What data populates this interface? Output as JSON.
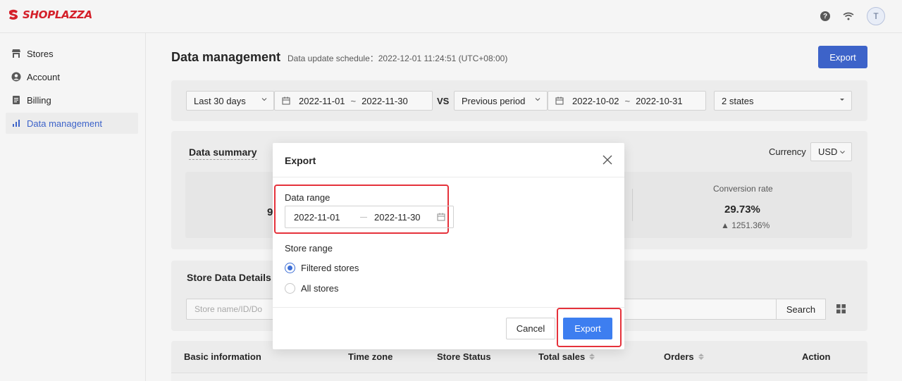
{
  "app": {
    "logo_text": "SHOPLAZZA",
    "avatar_initial": "T"
  },
  "sidebar": {
    "items": [
      {
        "label": "Stores",
        "icon": "store-icon"
      },
      {
        "label": "Account",
        "icon": "user-icon"
      },
      {
        "label": "Billing",
        "icon": "billing-icon"
      },
      {
        "label": "Data management",
        "icon": "bar-chart-icon",
        "active": true
      }
    ]
  },
  "page": {
    "title": "Data management",
    "schedule": "Data update schedule：2022-12-01 11:24:51 (UTC+08:00)",
    "export_label": "Export"
  },
  "filters": {
    "period": "Last 30 days",
    "range_start": "2022-11-01",
    "range_end": "2022-11-30",
    "tilde": "~",
    "vs_label": "VS",
    "compare_period": "Previous period",
    "compare_start": "2022-10-02",
    "compare_end": "2022-10-31",
    "states": "2 states"
  },
  "summary": {
    "title": "Data summary",
    "currency_label": "Currency",
    "currency_value": "USD",
    "partial_value": "9",
    "conversion_label": "Conversion rate",
    "conversion_value": "29.73%",
    "conversion_change": "▲ 1251.36%"
  },
  "store_details": {
    "title": "Store Data Details",
    "search_placeholder": "Store name/ID/Do",
    "search_button": "Search"
  },
  "table": {
    "columns": [
      {
        "label": "Basic information",
        "sortable": false
      },
      {
        "label": "Time zone",
        "sortable": false
      },
      {
        "label": "Store Status",
        "sortable": false
      },
      {
        "label": "Total sales",
        "sortable": true
      },
      {
        "label": "Orders",
        "sortable": true
      },
      {
        "label": "Action",
        "sortable": false
      }
    ]
  },
  "modal": {
    "title": "Export",
    "data_range_label": "Data range",
    "range_start": "2022-11-01",
    "range_end": "2022-11-30",
    "store_range_label": "Store range",
    "options": [
      {
        "label": "Filtered stores",
        "selected": true
      },
      {
        "label": "All stores",
        "selected": false
      }
    ],
    "cancel_label": "Cancel",
    "export_label": "Export"
  },
  "colors": {
    "brand": "#d4202a",
    "primary": "#3d63c9",
    "modal_primary": "#3d7ef0",
    "highlight": "#e5323b"
  }
}
